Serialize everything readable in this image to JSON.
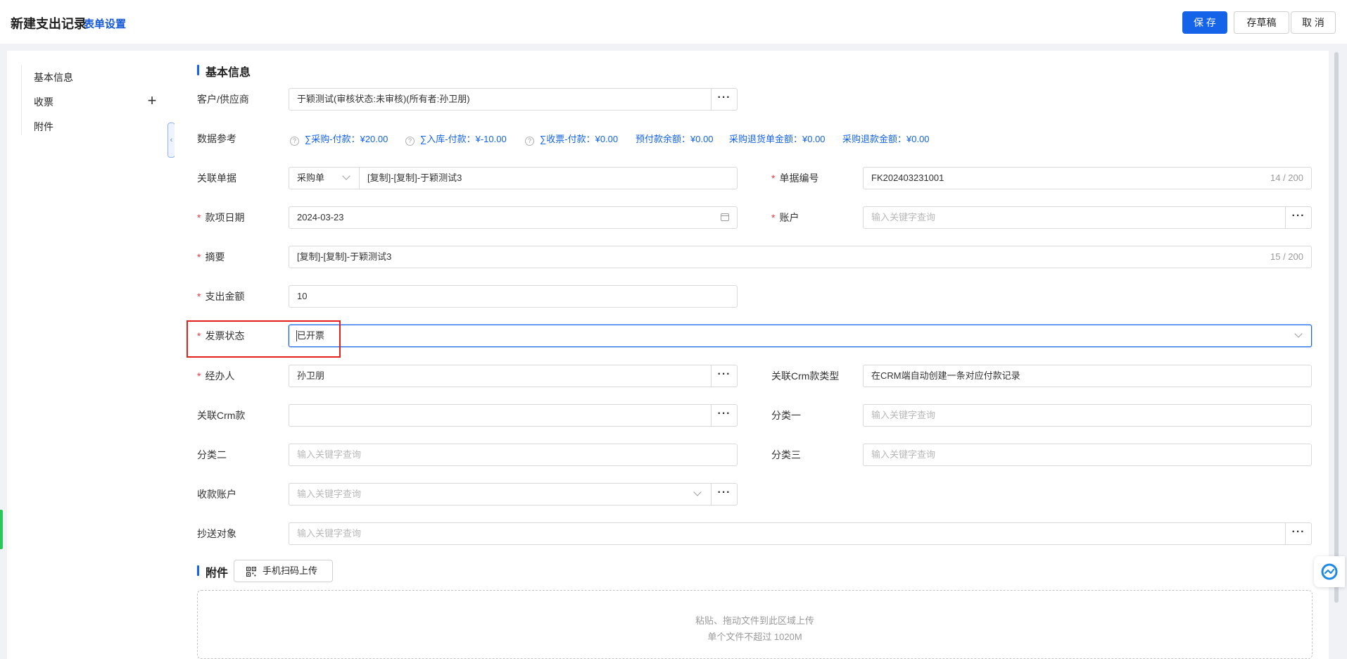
{
  "header": {
    "title": "新建支出记录",
    "form_settings": "表单设置",
    "save": "保 存",
    "draft": "存草稿",
    "cancel": "取 消"
  },
  "sidebar": {
    "items": [
      {
        "label": "基本信息"
      },
      {
        "label": "收票"
      },
      {
        "label": "附件"
      }
    ]
  },
  "sections": {
    "basic": "基本信息",
    "attachments": "附件"
  },
  "form": {
    "customer": {
      "label": "客户/供应商",
      "value": "于颖测试(审核状态:未审核)(所有者:孙卫朋)"
    },
    "data_ref": {
      "label": "数据参考",
      "items": [
        "∑采购-付款：¥20.00",
        "∑入库-付款：¥-10.00",
        "∑收票-付款：¥0.00",
        "预付款余额：¥0.00",
        "采购退货单金额：¥0.00",
        "采购退款金额：¥0.00"
      ]
    },
    "related_doc": {
      "label": "关联单据",
      "type": "采购单",
      "value": "[复制]-[复制]-于颖测试3"
    },
    "doc_no": {
      "label": "单据编号",
      "value": "FK202403231001",
      "count": "14 / 200"
    },
    "date": {
      "label": "款项日期",
      "value": "2024-03-23"
    },
    "account": {
      "label": "账户",
      "placeholder": "输入关键字查询"
    },
    "summary": {
      "label": "摘要",
      "value": "[复制]-[复制]-于颖测试3",
      "count": "15 / 200"
    },
    "amount": {
      "label": "支出金额",
      "value": "10"
    },
    "invoice_status": {
      "label": "发票状态",
      "value": "已开票"
    },
    "handler": {
      "label": "经办人",
      "value": "孙卫朋"
    },
    "crm_type": {
      "label": "关联Crm款类型",
      "value": "在CRM端自动创建一条对应付款记录"
    },
    "crm_payment": {
      "label": "关联Crm款",
      "value": ""
    },
    "cat1": {
      "label": "分类一",
      "placeholder": "输入关键字查询"
    },
    "cat2": {
      "label": "分类二",
      "placeholder": "输入关键字查询"
    },
    "cat3": {
      "label": "分类三",
      "placeholder": "输入关键字查询"
    },
    "receiving_account": {
      "label": "收款账户",
      "placeholder": "输入关键字查询"
    },
    "cc": {
      "label": "抄送对象",
      "placeholder": "输入关键字查询"
    }
  },
  "attachments": {
    "qr_upload": "手机扫码上传",
    "drop_line1": "粘贴、拖动文件到此区域上传",
    "drop_line2": "单个文件不超过 1020M"
  },
  "colors": {
    "primary": "#1463e8",
    "required": "#f0363f",
    "highlight": "#e3201b"
  }
}
